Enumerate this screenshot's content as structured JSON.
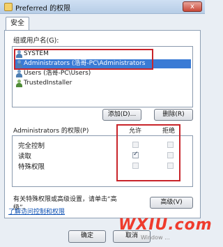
{
  "window": {
    "title": "Preferred 的权限",
    "close_label": "x"
  },
  "tabs": [
    {
      "label": "安全"
    }
  ],
  "group": {
    "label": "组或用户名(G):",
    "users": [
      {
        "name": "SYSTEM"
      },
      {
        "name": "Administrators (浩哥-PC\\Administrators"
      },
      {
        "name": "Users (浩哥-PC\\Users)"
      },
      {
        "name": "TrustedInstaller"
      }
    ],
    "selected_index": 1
  },
  "buttons": {
    "add": "添加(D)...",
    "remove": "删除(R)",
    "advanced": "高级(V)",
    "ok": "确定",
    "cancel": "取消"
  },
  "permissions": {
    "header": "Administrators 的权限(P)",
    "allow_label": "允许",
    "deny_label": "拒绝",
    "rows": [
      {
        "name": "完全控制",
        "allow": false,
        "deny": false
      },
      {
        "name": "读取",
        "allow": true,
        "deny": false
      },
      {
        "name": "特殊权限",
        "allow": false,
        "deny": false
      }
    ]
  },
  "help": {
    "text": "有关特殊权限或高级设置，请单击“高级”。"
  },
  "link": {
    "text": "了解访问控制和权限"
  },
  "watermark": {
    "text": "WXIU.com",
    "sub": "Window ..."
  },
  "colors": {
    "selection": "#3a7bd5",
    "highlight_red": "#c8242a",
    "link": "#0b4fb3"
  }
}
